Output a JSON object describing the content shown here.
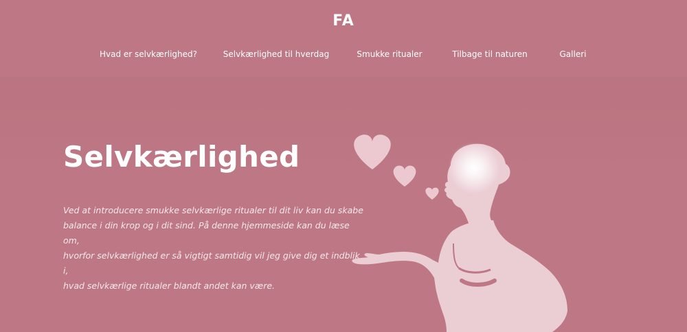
{
  "header": {
    "logo_text": "FA"
  },
  "nav": {
    "items": [
      {
        "label": "Hvad er selvkærlighed?"
      },
      {
        "label": "Selvkærlighed til hverdag"
      },
      {
        "label": "Smukke ritualer"
      },
      {
        "label": "Tilbage til naturen"
      },
      {
        "label": "Galleri"
      }
    ]
  },
  "hero": {
    "title": "Selvkærlighed",
    "paragraph_lines": [
      "Ved at introducere smukke selvkærlige ritualer til dit liv kan du skabe",
      "balance i din krop og i dit sind. På denne hjemmeside kan du læse om,",
      "hvorfor selvkærlighed er så vigtigt samtidig vil jeg give dig et indblik i,",
      "hvad selvkærlige ritualer blandt andet kan være."
    ]
  },
  "colors": {
    "background": "#be7784",
    "text": "#ffffff",
    "illustration": "#f0d3da"
  },
  "icons": [
    "heart-icon",
    "woman-silhouette"
  ]
}
